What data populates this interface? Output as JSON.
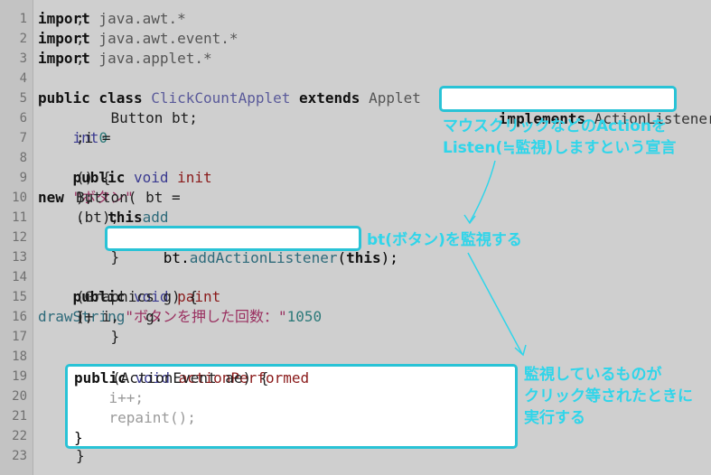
{
  "lines": [
    {
      "n": "1",
      "parts": [
        [
          "kw",
          "import"
        ],
        [
          "pkg",
          " java.awt.*"
        ],
        [
          "code",
          ";"
        ]
      ]
    },
    {
      "n": "2",
      "parts": [
        [
          "kw",
          "import"
        ],
        [
          "pkg",
          " java.awt.event.*"
        ],
        [
          "code",
          ";"
        ]
      ]
    },
    {
      "n": "3",
      "parts": [
        [
          "kw",
          "import"
        ],
        [
          "pkg",
          " java.applet.*"
        ],
        [
          "code",
          ";"
        ]
      ]
    },
    {
      "n": "4",
      "parts": []
    },
    {
      "n": "5",
      "parts": [
        [
          "kw",
          "public class "
        ],
        [
          "cls",
          "ClickCountApplet"
        ],
        [
          "kw",
          " extends "
        ],
        [
          "pkg",
          "Applet"
        ]
      ]
    },
    {
      "n": "6",
      "parts": [
        [
          "code",
          "    Button bt;"
        ]
      ]
    },
    {
      "n": "7",
      "parts": [
        [
          "kwb",
          "    int"
        ],
        [
          "code",
          " i = "
        ],
        [
          "num",
          "0"
        ],
        [
          "code",
          ";"
        ]
      ]
    },
    {
      "n": "8",
      "parts": []
    },
    {
      "n": "9",
      "parts": [
        [
          "kw",
          "    public "
        ],
        [
          "kwb",
          "void "
        ],
        [
          "mth",
          "init"
        ],
        [
          "code",
          "() {"
        ]
      ]
    },
    {
      "n": "10",
      "parts": [
        [
          "code",
          "        bt = "
        ],
        [
          "kw",
          "new "
        ],
        [
          "code",
          "Button("
        ],
        [
          "str",
          "\"ボタン\""
        ],
        [
          "code",
          ");"
        ]
      ]
    },
    {
      "n": "11",
      "parts": [
        [
          "kw",
          "        this"
        ],
        [
          "code",
          "."
        ],
        [
          "call",
          "add"
        ],
        [
          "code",
          "(bt);"
        ]
      ]
    },
    {
      "n": "12",
      "parts": []
    },
    {
      "n": "13",
      "parts": [
        [
          "code",
          "    }"
        ]
      ]
    },
    {
      "n": "14",
      "parts": []
    },
    {
      "n": "15",
      "parts": [
        [
          "kw",
          "    public "
        ],
        [
          "kwb",
          "void "
        ],
        [
          "mth",
          "paint"
        ],
        [
          "code",
          "(Graphics g) {"
        ]
      ]
    },
    {
      "n": "16",
      "parts": [
        [
          "code",
          "        g."
        ],
        [
          "call",
          "drawString"
        ],
        [
          "code",
          "("
        ],
        [
          "str",
          "\"ボタンを押した回数：\""
        ],
        [
          "code",
          " + i, "
        ],
        [
          "num",
          "10"
        ],
        [
          "code",
          ", "
        ],
        [
          "num",
          "50"
        ],
        [
          "code",
          ");"
        ]
      ]
    },
    {
      "n": "17",
      "parts": [
        [
          "code",
          "    }"
        ]
      ]
    },
    {
      "n": "18",
      "parts": []
    },
    {
      "n": "19",
      "parts": []
    },
    {
      "n": "20",
      "parts": []
    },
    {
      "n": "21",
      "parts": []
    },
    {
      "n": "22",
      "parts": []
    },
    {
      "n": "23",
      "parts": [
        [
          "code",
          "}"
        ]
      ]
    }
  ],
  "box_implements": {
    "kw": "implements",
    "cls": " ActionListener"
  },
  "after_box_brace": " {",
  "box_listener": {
    "obj": "bt.",
    "call": "addActionListener",
    "arg_open": "(",
    "kw": "this",
    "close": ");"
  },
  "box_action": {
    "sig": [
      [
        "kw",
        "public "
      ],
      [
        "kwb",
        "void "
      ],
      [
        "mth",
        "actionPerformed"
      ],
      [
        "code",
        "(ActionEvent ae) {"
      ]
    ],
    "l20": "    i++;",
    "l21_a": "    repaint",
    "l21_b": "();",
    "l22": "}"
  },
  "annotations": {
    "a1_line1": "マウスクリックなどのActionを",
    "a1_line2": "Listen(≒監視)しますという宣言",
    "a2": "bt(ボタン)を監視する",
    "a3_line1": "監視しているものが",
    "a3_line2": "クリック等されたときに",
    "a3_line3": "実行する"
  },
  "colors": {
    "accent": "#29c3d6",
    "annotation": "#2fd5ea"
  }
}
